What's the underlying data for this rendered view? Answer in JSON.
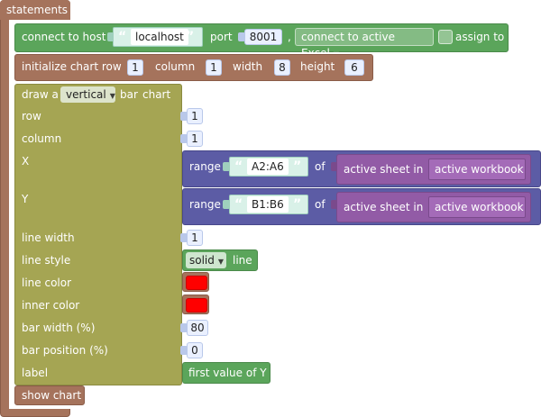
{
  "statements_label": "statements",
  "connect": {
    "label": "connect to host",
    "host_quote_open": "“",
    "host_quote_close": "”",
    "host_value": "localhost",
    "port_label": "port",
    "port_value": "8001",
    "separator": ",",
    "mode_value": "connect to active Excel",
    "assign_label": "assign to"
  },
  "init": {
    "label": "initialize chart row",
    "row_value": "1",
    "column_label": "column",
    "column_value": "1",
    "width_label": "width",
    "width_value": "8",
    "height_label": "height",
    "height_value": "6"
  },
  "draw": {
    "prefix": "draw a",
    "orientation": "vertical",
    "suffix_bar": "bar",
    "suffix_chart": "chart",
    "row_label": "row",
    "row_value": "1",
    "column_label": "column",
    "column_value": "1",
    "x_label": "X",
    "y_label": "Y",
    "line_width_label": "line width",
    "line_width_value": "1",
    "line_style_label": "line style",
    "line_style_value": "solid",
    "line_style_suffix": "line",
    "line_color_label": "line color",
    "line_color": "#ff0000",
    "inner_color_label": "inner color",
    "inner_color": "#ff0000",
    "bar_width_label": "bar width (%)",
    "bar_width_value": "80",
    "bar_position_label": "bar position (%)",
    "bar_position_value": "0",
    "label_label": "label",
    "label_value": "first value of Y"
  },
  "range_x": {
    "label": "range",
    "value": "A2:A6",
    "of_label": "of",
    "sheet_label": "active sheet in",
    "workbook_label": "active workbook"
  },
  "range_y": {
    "label": "range",
    "value": "B1:B6",
    "of_label": "of",
    "sheet_label": "active sheet in",
    "workbook_label": "active workbook"
  },
  "show_chart_label": "show chart",
  "colors": {
    "statement": "#a5735c",
    "connect": "#5ba55b",
    "draw": "#a5a553",
    "range": "#5c5ca5",
    "sheet": "#925ba6"
  }
}
